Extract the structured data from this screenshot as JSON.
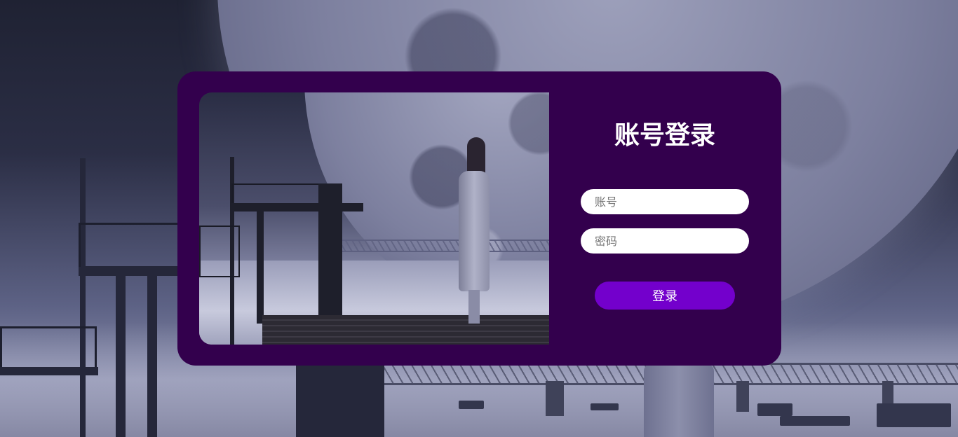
{
  "login": {
    "title": "账号登录",
    "account": {
      "placeholder": "账号",
      "value": ""
    },
    "password": {
      "placeholder": "密码",
      "value": ""
    },
    "submit_label": "登录"
  },
  "colors": {
    "card_background": "#33004d",
    "button_background": "#7300cc",
    "input_background": "#ffffff",
    "title_text": "#ffffff"
  }
}
